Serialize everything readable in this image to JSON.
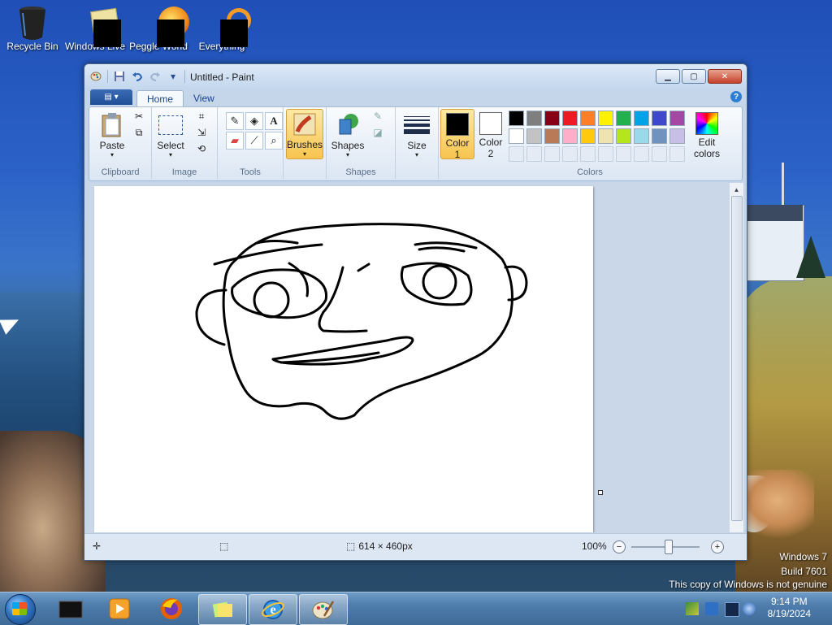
{
  "desktop": {
    "icons": [
      {
        "label": "Recycle Bin"
      },
      {
        "label": "Windows Live"
      },
      {
        "label": "Peggle World"
      },
      {
        "label": "Everything"
      }
    ],
    "watermark": {
      "line1": "Windows 7",
      "line2": "Build 7601",
      "line3": "This copy of Windows is not genuine"
    }
  },
  "window": {
    "title": "Untitled - Paint",
    "tabs": {
      "home": "Home",
      "view": "View"
    },
    "ribbon": {
      "clipboard": {
        "label": "Clipboard",
        "paste": "Paste"
      },
      "image": {
        "label": "Image",
        "select": "Select"
      },
      "tools": {
        "label": "Tools"
      },
      "brushes": {
        "label": "Brushes"
      },
      "shapes": {
        "label": "Shapes",
        "button": "Shapes"
      },
      "size": {
        "label": "Size"
      },
      "colors": {
        "label": "Colors",
        "color1_label": "Color",
        "color1_num": "1",
        "color2_label": "Color",
        "color2_num": "2",
        "edit_label_1": "Edit",
        "edit_label_2": "colors",
        "color1": "#000000",
        "color2": "#ffffff",
        "palette_row1": [
          "#000000",
          "#7f7f7f",
          "#880015",
          "#ed1c24",
          "#ff7f27",
          "#fff200",
          "#22b14c",
          "#00a2e8",
          "#3f48cc",
          "#a349a4"
        ],
        "palette_row2": [
          "#ffffff",
          "#c3c3c3",
          "#b97a57",
          "#ffaec9",
          "#ffc90e",
          "#efe4b0",
          "#b5e61d",
          "#99d9ea",
          "#7092be",
          "#c8bfe7"
        ]
      }
    },
    "status": {
      "dimensions": "614 × 460px",
      "zoom": "100%"
    }
  },
  "taskbar": {
    "time": "9:14 PM",
    "date": "8/19/2024"
  }
}
